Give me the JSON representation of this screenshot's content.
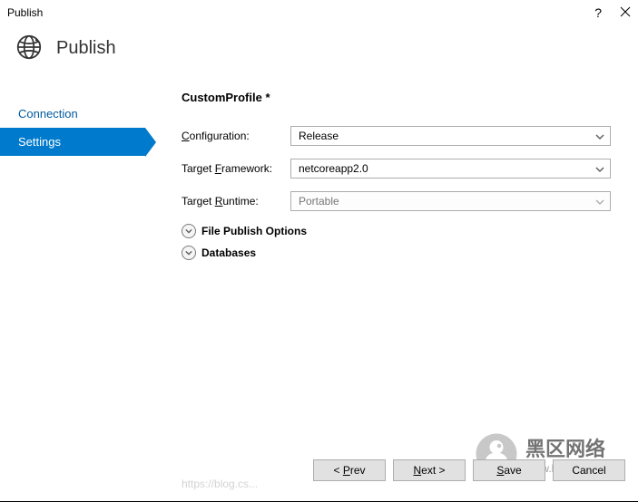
{
  "window": {
    "title": "Publish"
  },
  "header": {
    "title": "Publish"
  },
  "sidebar": {
    "items": [
      {
        "label": "Connection",
        "active": false
      },
      {
        "label": "Settings",
        "active": true
      }
    ]
  },
  "main": {
    "profile_name": "CustomProfile *",
    "fields": {
      "configuration": {
        "label": "Configuration:",
        "value": "Release"
      },
      "target_framework": {
        "label": "Target Framework:",
        "value": "netcoreapp2.0"
      },
      "target_runtime": {
        "label": "Target Runtime:",
        "value": "Portable"
      }
    },
    "expanders": {
      "file_publish": "File Publish Options",
      "databases": "Databases"
    }
  },
  "footer": {
    "prev": "< Prev",
    "next": "Next >",
    "save": "Save",
    "cancel": "Cancel"
  },
  "watermark": {
    "link": "https://blog.cs...",
    "brand_main": "黑区网络",
    "brand_sub": "www.hc1qu.com"
  }
}
